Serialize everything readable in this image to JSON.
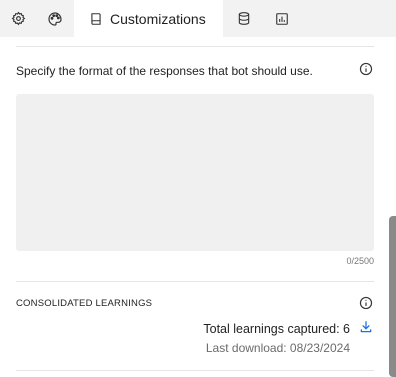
{
  "tabs": [
    {
      "icon": "gear-icon"
    },
    {
      "icon": "palette-icon"
    },
    {
      "icon": "book-icon",
      "label": "Customizations",
      "active": true
    },
    {
      "icon": "database-icon"
    },
    {
      "icon": "bar-chart-icon"
    }
  ],
  "format": {
    "description": "Specify the format of the responses that bot should use.",
    "value": "",
    "counter": "0/2500"
  },
  "learnings": {
    "title": "CONSOLIDATED LEARNINGS",
    "count_text": "Total learnings captured: 6",
    "last_download": "Last download: 08/23/2024"
  },
  "colors": {
    "tabbar_bg": "#f2f2f3",
    "textarea_bg": "#f0f0f1",
    "link_blue": "#1a73e8"
  }
}
